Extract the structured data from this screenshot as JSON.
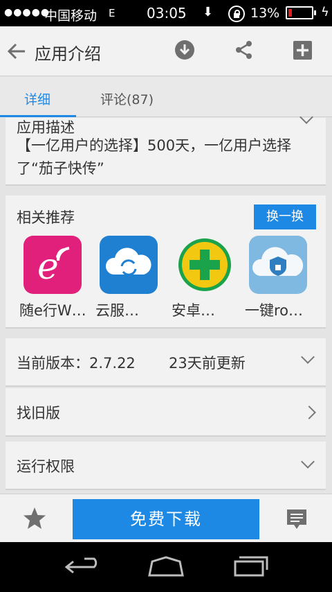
{
  "status_bar": {
    "signal": "●●●●●",
    "carrier": "中国移动",
    "network": "E",
    "time": "03:05",
    "battery_percent": "13%"
  },
  "title_bar": {
    "title": "应用介绍"
  },
  "tabs": [
    {
      "label": "详细",
      "active": true
    },
    {
      "label": "评论(87)",
      "active": false
    }
  ],
  "description": {
    "title": "应用描述",
    "text": "【一亿用户的选择】500天，一亿用户选择了“茄子快传”"
  },
  "recommend": {
    "title": "相关推荐",
    "swap_label": "换一换",
    "apps": [
      {
        "name": "随e行W…",
        "icon": "wifi-e-icon"
      },
      {
        "name": "云服…",
        "icon": "cloud-sync-icon"
      },
      {
        "name": "安卓…",
        "icon": "plus-shield-icon"
      },
      {
        "name": "一键ro…",
        "icon": "cloud-lock-icon"
      }
    ]
  },
  "version_row": {
    "label": "当前版本：2.7.22",
    "updated": "23天前更新"
  },
  "old_version_row": {
    "label": "找旧版"
  },
  "permissions_row": {
    "label": "运行权限"
  },
  "action_bar": {
    "download_label": "免费下载"
  },
  "colors": {
    "accent": "#1e88e5",
    "app1": "#e0207a",
    "app2": "#1f7fd0",
    "app3": "#f2c811",
    "app4": "#7fb8e0"
  }
}
